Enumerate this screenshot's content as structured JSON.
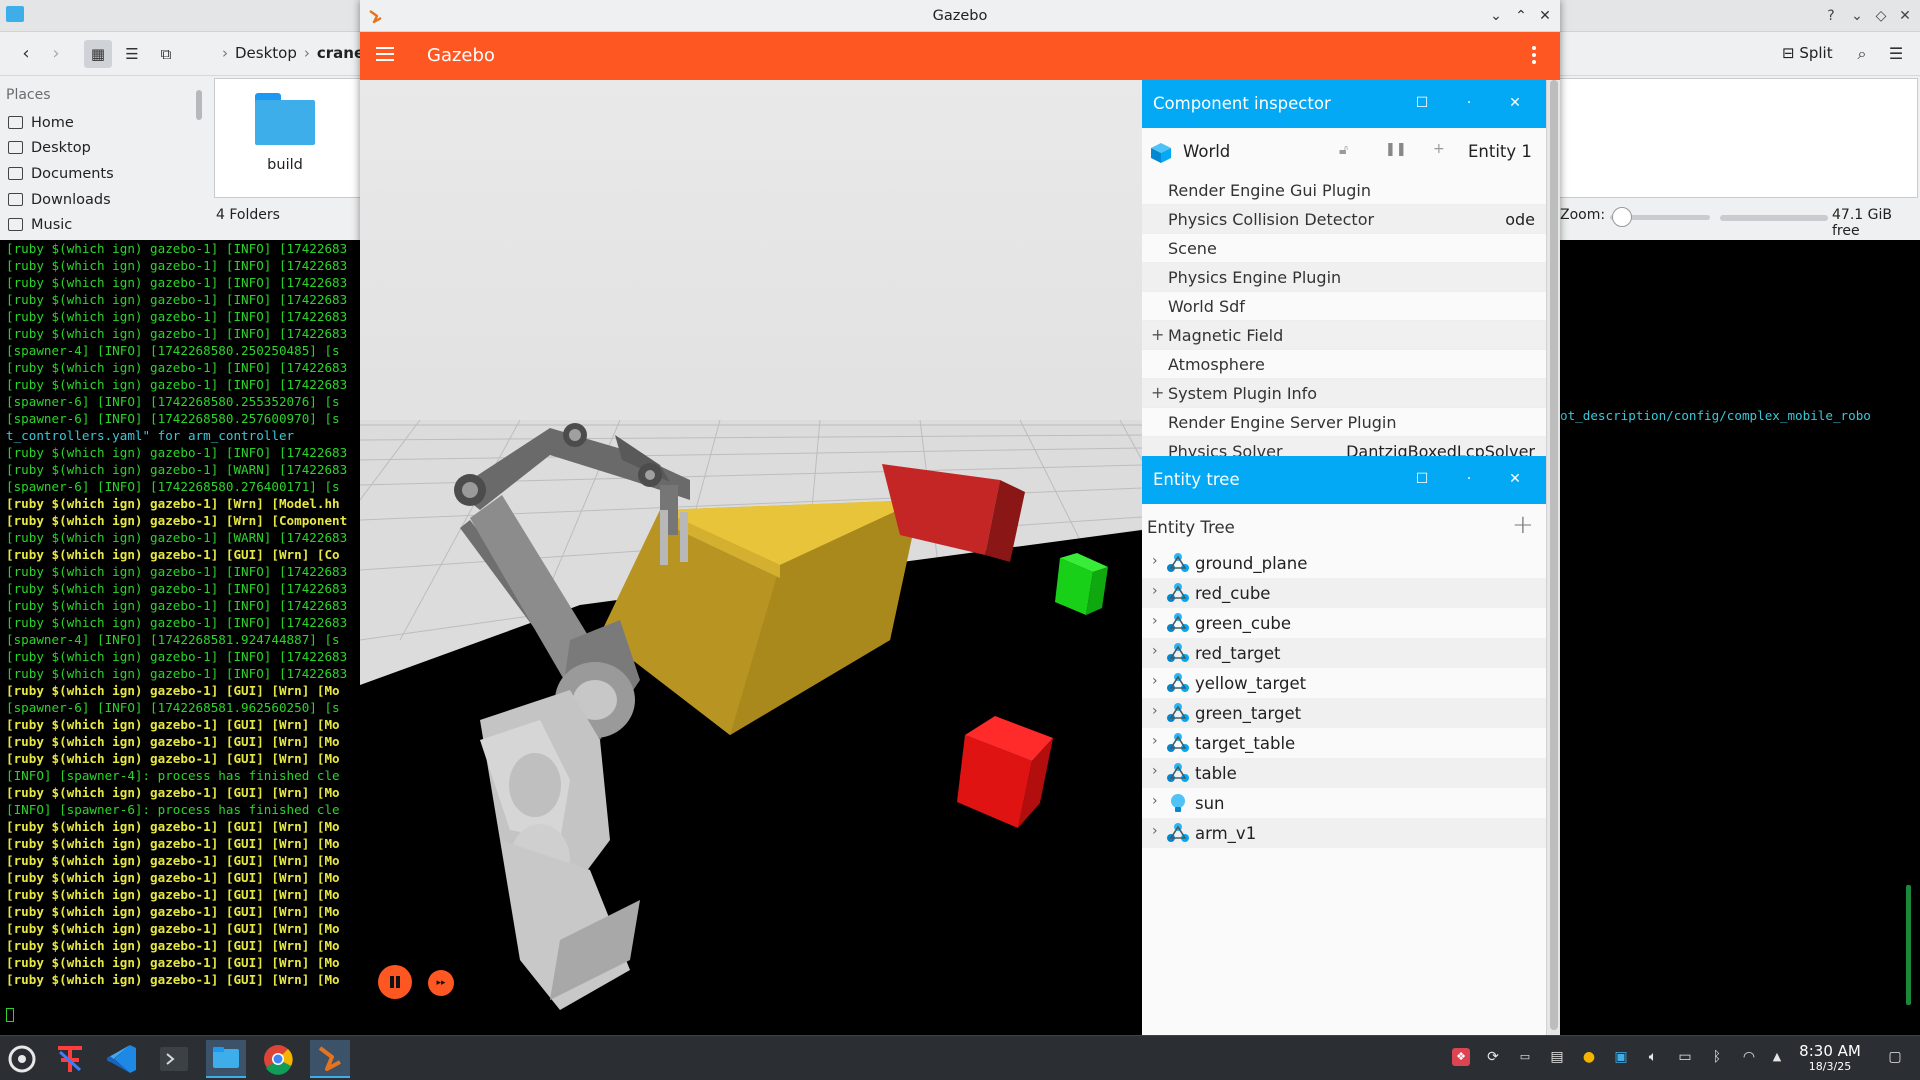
{
  "file_manager": {
    "breadcrumb": [
      "Desktop",
      "crane"
    ],
    "split_label": "Split",
    "places_title": "Places",
    "places": [
      "Home",
      "Desktop",
      "Documents",
      "Downloads",
      "Music"
    ],
    "folders": [
      "build"
    ],
    "status": "4 Folders",
    "zoom_label": "Zoom:",
    "zoom_level": 0.12,
    "free_space": "47.1 GiB free"
  },
  "terminal": {
    "lines": [
      {
        "t": "[ruby $(which ign) gazebo-1] [INFO] [17422683",
        "c": "green"
      },
      {
        "t": "[ruby $(which ign) gazebo-1] [INFO] [17422683",
        "c": "green"
      },
      {
        "t": "[ruby $(which ign) gazebo-1] [INFO] [17422683",
        "c": "green"
      },
      {
        "t": "[ruby $(which ign) gazebo-1] [INFO] [17422683",
        "c": "green"
      },
      {
        "t": "[ruby $(which ign) gazebo-1] [INFO] [17422683",
        "c": "green"
      },
      {
        "t": "[ruby $(which ign) gazebo-1] [INFO] [17422683",
        "c": "green"
      },
      {
        "t": "[spawner-4] [INFO] [1742268580.250250485] [s",
        "c": "green"
      },
      {
        "t": "[ruby $(which ign) gazebo-1] [INFO] [17422683",
        "c": "green"
      },
      {
        "t": "[ruby $(which ign) gazebo-1] [INFO] [17422683",
        "c": "green"
      },
      {
        "t": "[spawner-6] [INFO] [1742268580.255352076] [s",
        "c": "green"
      },
      {
        "t": "[spawner-6] [INFO] [1742268580.257600970] [s",
        "c": "green"
      },
      {
        "t": "t_controllers.yaml\" for arm_controller",
        "c": "cyan"
      },
      {
        "t": "[ruby $(which ign) gazebo-1] [INFO] [17422683",
        "c": "green"
      },
      {
        "t": "[ruby $(which ign) gazebo-1] [WARN] [17422683",
        "c": "green"
      },
      {
        "t": "[spawner-6] [INFO] [1742268580.276400171] [s",
        "c": "green"
      },
      {
        "t": "[ruby $(which ign) gazebo-1] [Wrn] [Model.hh",
        "c": "yellow"
      },
      {
        "t": "[ruby $(which ign) gazebo-1] [Wrn] [Component",
        "c": "yellow"
      },
      {
        "t": "[ruby $(which ign) gazebo-1] [WARN] [17422683",
        "c": "green"
      },
      {
        "t": "[ruby $(which ign) gazebo-1] [GUI] [Wrn] [Co",
        "c": "yellow"
      },
      {
        "t": "[ruby $(which ign) gazebo-1] [INFO] [17422683",
        "c": "green"
      },
      {
        "t": "[ruby $(which ign) gazebo-1] [INFO] [17422683",
        "c": "green"
      },
      {
        "t": "[ruby $(which ign) gazebo-1] [INFO] [17422683",
        "c": "green"
      },
      {
        "t": "[ruby $(which ign) gazebo-1] [INFO] [17422683",
        "c": "green"
      },
      {
        "t": "[spawner-4] [INFO] [1742268581.924744887] [s",
        "c": "green"
      },
      {
        "t": "[ruby $(which ign) gazebo-1] [INFO] [17422683",
        "c": "green"
      },
      {
        "t": "[ruby $(which ign) gazebo-1] [INFO] [17422683",
        "c": "green"
      },
      {
        "t": "[ruby $(which ign) gazebo-1] [GUI] [Wrn] [Mo",
        "c": "yellow"
      },
      {
        "t": "[spawner-6] [INFO] [1742268581.962560250] [s",
        "c": "green"
      },
      {
        "t": "[ruby $(which ign) gazebo-1] [GUI] [Wrn] [Mo",
        "c": "yellow"
      },
      {
        "t": "[ruby $(which ign) gazebo-1] [GUI] [Wrn] [Mo",
        "c": "yellow"
      },
      {
        "t": "[ruby $(which ign) gazebo-1] [GUI] [Wrn] [Mo",
        "c": "yellow"
      },
      {
        "t": "[INFO] [spawner-4]: process has finished cle",
        "c": "green"
      },
      {
        "t": "[ruby $(which ign) gazebo-1] [GUI] [Wrn] [Mo",
        "c": "yellow"
      },
      {
        "t": "[INFO] [spawner-6]: process has finished cle",
        "c": "green"
      },
      {
        "t": "[ruby $(which ign) gazebo-1] [GUI] [Wrn] [Mo",
        "c": "yellow"
      },
      {
        "t": "[ruby $(which ign) gazebo-1] [GUI] [Wrn] [Mo",
        "c": "yellow"
      },
      {
        "t": "[ruby $(which ign) gazebo-1] [GUI] [Wrn] [Mo",
        "c": "yellow"
      },
      {
        "t": "[ruby $(which ign) gazebo-1] [GUI] [Wrn] [Mo",
        "c": "yellow"
      },
      {
        "t": "[ruby $(which ign) gazebo-1] [GUI] [Wrn] [Mo",
        "c": "yellow"
      },
      {
        "t": "[ruby $(which ign) gazebo-1] [GUI] [Wrn] [Mo",
        "c": "yellow"
      },
      {
        "t": "[ruby $(which ign) gazebo-1] [GUI] [Wrn] [Mo",
        "c": "yellow"
      },
      {
        "t": "[ruby $(which ign) gazebo-1] [GUI] [Wrn] [Mo",
        "c": "yellow"
      },
      {
        "t": "[ruby $(which ign) gazebo-1] [GUI] [Wrn] [Mo",
        "c": "yellow"
      },
      {
        "t": "[ruby $(which ign) gazebo-1] [GUI] [Wrn] [Mo",
        "c": "yellow"
      }
    ],
    "right_text": "ot_description/config/complex_mobile_robo"
  },
  "gazebo": {
    "window_title": "Gazebo",
    "app_name": "Gazebo",
    "component_inspector": {
      "title": "Component inspector",
      "entity_name": "World",
      "entity_id": "Entity 1",
      "rows": [
        {
          "label": "Render Engine Gui Plugin",
          "value": "",
          "expand": ""
        },
        {
          "label": "Physics Collision Detector",
          "value": "ode",
          "expand": ""
        },
        {
          "label": "Scene",
          "value": "",
          "expand": ""
        },
        {
          "label": "Physics Engine Plugin",
          "value": "",
          "expand": ""
        },
        {
          "label": "World Sdf",
          "value": "",
          "expand": ""
        },
        {
          "label": "Magnetic Field",
          "value": "",
          "expand": "+"
        },
        {
          "label": "Atmosphere",
          "value": "",
          "expand": ""
        },
        {
          "label": "System Plugin Info",
          "value": "",
          "expand": "+"
        },
        {
          "label": "Render Engine Server Plugin",
          "value": "",
          "expand": ""
        },
        {
          "label": "Physics Solver",
          "value": "DantzigBoxedLcpSolver",
          "expand": ""
        }
      ]
    },
    "entity_tree": {
      "title": "Entity tree",
      "header": "Entity Tree",
      "items": [
        {
          "label": "ground_plane",
          "icon": "model-icon"
        },
        {
          "label": "red_cube",
          "icon": "model-icon"
        },
        {
          "label": "green_cube",
          "icon": "model-icon"
        },
        {
          "label": "red_target",
          "icon": "model-icon"
        },
        {
          "label": "yellow_target",
          "icon": "model-icon"
        },
        {
          "label": "green_target",
          "icon": "model-icon"
        },
        {
          "label": "target_table",
          "icon": "model-icon"
        },
        {
          "label": "table",
          "icon": "model-icon"
        },
        {
          "label": "sun",
          "icon": "light-icon"
        },
        {
          "label": "arm_v1",
          "icon": "model-icon"
        }
      ]
    },
    "colors": {
      "appbar": "#ff5722",
      "panel_header": "#03a9f4",
      "red_cube": "#e01313",
      "green_cube": "#16d816",
      "yellow_box": "#d8b128"
    }
  },
  "taskbar": {
    "time": "8:30 AM",
    "date": "18/3/25"
  }
}
